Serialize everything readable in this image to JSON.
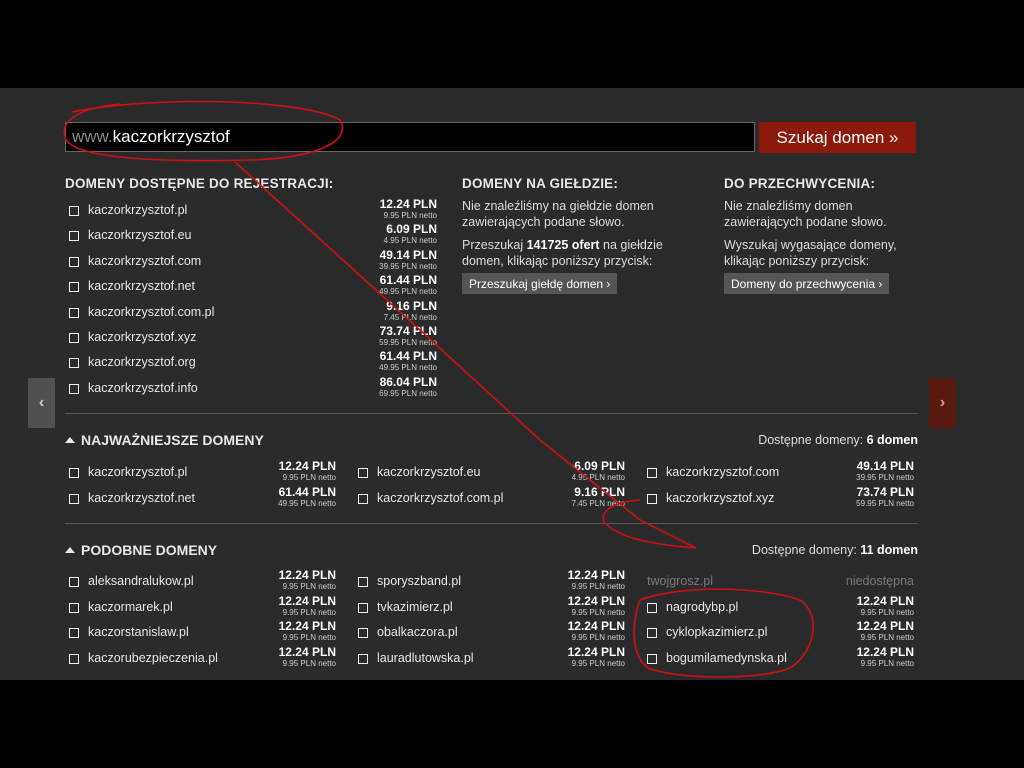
{
  "search": {
    "prefix": "www.",
    "term": "kaczorkrzysztof",
    "button": "Szukaj domen »"
  },
  "nav": {
    "prev": "‹",
    "next": "›"
  },
  "available": {
    "title": "DOMENY DOSTĘPNE DO REJESTRACJI:",
    "items": [
      {
        "name": "kaczorkrzysztof.pl",
        "gross": "12.24 PLN",
        "net": "9.95 PLN netto"
      },
      {
        "name": "kaczorkrzysztof.eu",
        "gross": "6.09 PLN",
        "net": "4.95 PLN netto"
      },
      {
        "name": "kaczorkrzysztof.com",
        "gross": "49.14 PLN",
        "net": "39.95 PLN netto"
      },
      {
        "name": "kaczorkrzysztof.net",
        "gross": "61.44 PLN",
        "net": "49.95 PLN netto"
      },
      {
        "name": "kaczorkrzysztof.com.pl",
        "gross": "9.16 PLN",
        "net": "7.45 PLN netto"
      },
      {
        "name": "kaczorkrzysztof.xyz",
        "gross": "73.74 PLN",
        "net": "59.95 PLN netto"
      },
      {
        "name": "kaczorkrzysztof.org",
        "gross": "61.44 PLN",
        "net": "49.95 PLN netto"
      },
      {
        "name": "kaczorkrzysztof.info",
        "gross": "86.04 PLN",
        "net": "69.95 PLN netto"
      }
    ]
  },
  "exchange": {
    "title": "DOMENY NA GIEŁDZIE:",
    "text1": "Nie znaleźliśmy na giełdzie domen zawierających podane słowo.",
    "text2_pre": "Przeszukaj ",
    "text2_bold": "141725 ofert",
    "text2_post": " na giełdzie domen, klikając poniższy przycisk:",
    "button": "Przeszukaj giełdę domen ›"
  },
  "catch": {
    "title": "DO PRZECHWYCENIA:",
    "text1": "Nie znaleźliśmy domen zawierających podane słowo.",
    "text2": "Wyszukaj wygasające domeny, klikając poniższy przycisk:",
    "button": "Domeny do przechwycenia ›"
  },
  "important": {
    "title": "NAJWAŻNIEJSZE DOMENY",
    "avail_label": "Dostępne domeny: ",
    "avail_count": "6 domen",
    "items": [
      {
        "name": "kaczorkrzysztof.pl",
        "gross": "12.24 PLN",
        "net": "9.95 PLN netto"
      },
      {
        "name": "kaczorkrzysztof.eu",
        "gross": "6.09 PLN",
        "net": "4.95 PLN netto"
      },
      {
        "name": "kaczorkrzysztof.com",
        "gross": "49.14 PLN",
        "net": "39.95 PLN netto"
      },
      {
        "name": "kaczorkrzysztof.net",
        "gross": "61.44 PLN",
        "net": "49.95 PLN netto"
      },
      {
        "name": "kaczorkrzysztof.com.pl",
        "gross": "9.16 PLN",
        "net": "7.45 PLN netto"
      },
      {
        "name": "kaczorkrzysztof.xyz",
        "gross": "73.74 PLN",
        "net": "59.95 PLN netto"
      }
    ]
  },
  "similar": {
    "title": "PODOBNE DOMENY",
    "avail_label": "Dostępne domeny: ",
    "avail_count": "11 domen",
    "items": [
      {
        "name": "aleksandralukow.pl",
        "gross": "12.24 PLN",
        "net": "9.95 PLN netto"
      },
      {
        "name": "sporyszband.pl",
        "gross": "12.24 PLN",
        "net": "9.95 PLN netto"
      },
      {
        "name": "twojgrosz.pl",
        "status": "niedostępna"
      },
      {
        "name": "kaczormarek.pl",
        "gross": "12.24 PLN",
        "net": "9.95 PLN netto"
      },
      {
        "name": "tvkazimierz.pl",
        "gross": "12.24 PLN",
        "net": "9.95 PLN netto"
      },
      {
        "name": "nagrodybp.pl",
        "gross": "12.24 PLN",
        "net": "9.95 PLN netto"
      },
      {
        "name": "kaczorstanislaw.pl",
        "gross": "12.24 PLN",
        "net": "9.95 PLN netto"
      },
      {
        "name": "obalkaczora.pl",
        "gross": "12.24 PLN",
        "net": "9.95 PLN netto"
      },
      {
        "name": "cyklopkazimierz.pl",
        "gross": "12.24 PLN",
        "net": "9.95 PLN netto"
      },
      {
        "name": "kaczorubezpieczenia.pl",
        "gross": "12.24 PLN",
        "net": "9.95 PLN netto"
      },
      {
        "name": "lauradlutowska.pl",
        "gross": "12.24 PLN",
        "net": "9.95 PLN netto"
      },
      {
        "name": "bogumilamedynska.pl",
        "gross": "12.24 PLN",
        "net": "9.95 PLN netto"
      }
    ]
  },
  "colors": {
    "accent": "#8b1a0c",
    "panel": "#2b2b2b",
    "annotation": "#d01010"
  }
}
